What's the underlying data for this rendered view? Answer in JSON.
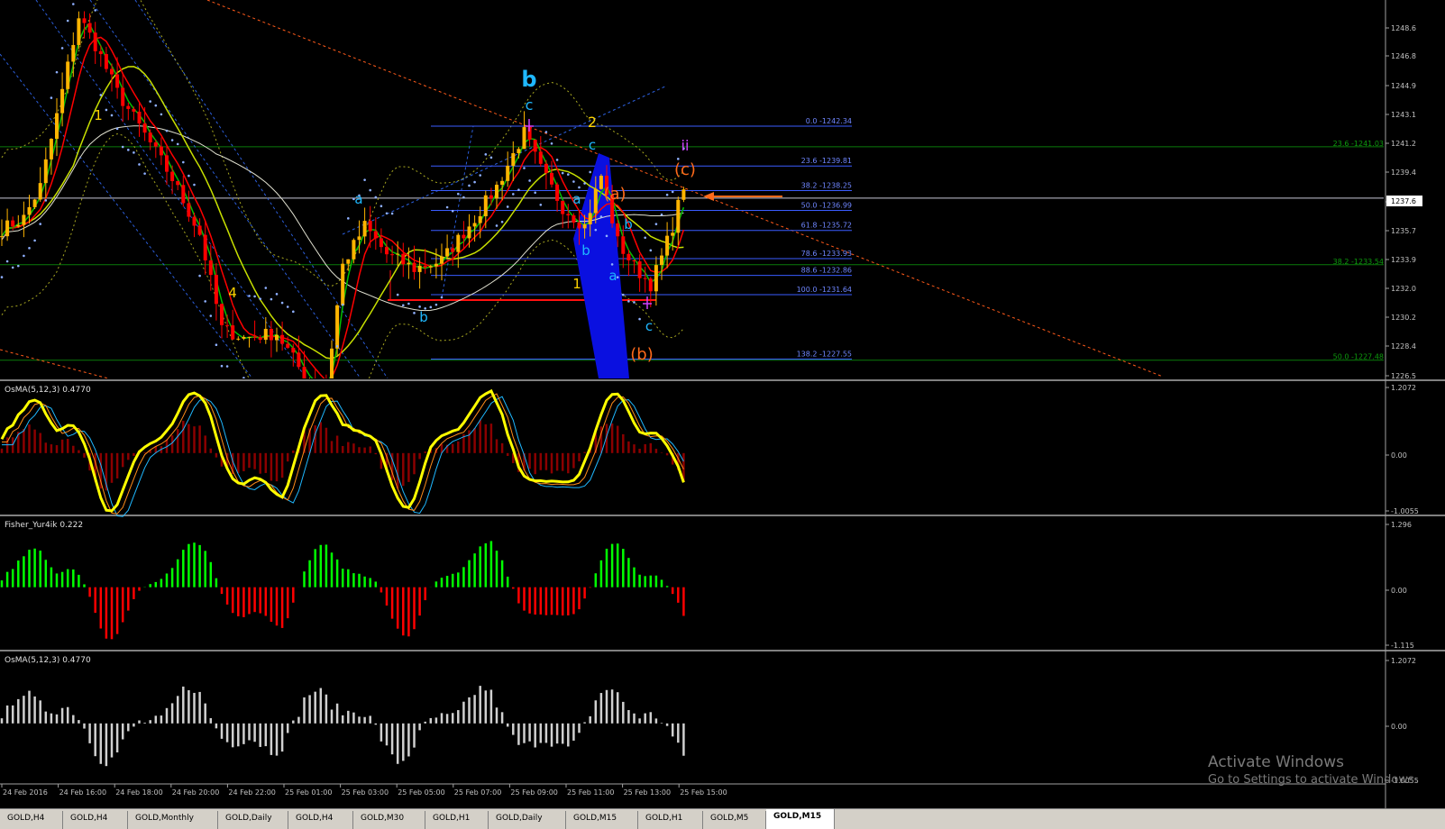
{
  "colors": {
    "bull": "#ffb400",
    "bear": "#ff0000",
    "ma_fast": "#00c000",
    "ma_mid": "#ff0000",
    "ma_slow": "#c8e000",
    "ma_long": "#e0e0d0",
    "fib": "#3a5cff",
    "green_line": "#0a7a0a",
    "osma_line": "#ffff00",
    "fisher_up": "#00ff00",
    "fisher_dn": "#ff0000",
    "osma_hist": "#d0d0d0",
    "wave_cyan": "#1fb8ff",
    "wave_yellow": "#ffd400",
    "wave_orange": "#ff6a1a",
    "wave_magenta": "#d040ff"
  },
  "price_axis": {
    "labels": [
      "1248.6",
      "1246.8",
      "1244.9",
      "1243.1",
      "1241.2",
      "1239.4",
      "1237.6",
      "1235.7",
      "1233.9",
      "1232.0",
      "1230.2",
      "1228.4",
      "1226.5"
    ],
    "current": "1237.6"
  },
  "fib_levels": [
    {
      "label": "0.0 -1242.34",
      "price": 1242.34
    },
    {
      "label": "23.6 -1239.81",
      "price": 1239.81
    },
    {
      "label": "38.2 -1238.25",
      "price": 1238.25
    },
    {
      "label": "50.0 -1236.99",
      "price": 1236.99
    },
    {
      "label": "61.8 -1235.72",
      "price": 1235.72
    },
    {
      "label": "78.6 -1233.93",
      "price": 1233.93
    },
    {
      "label": "88.6 -1232.86",
      "price": 1232.86
    },
    {
      "label": "100.0 -1231.64",
      "price": 1231.64
    },
    {
      "label": "138.2 -1227.55",
      "price": 1227.55
    }
  ],
  "green_levels": [
    {
      "label": "23.6 -1241.03",
      "price": 1241.03
    },
    {
      "label": "38.2 -1233.54",
      "price": 1233.54
    },
    {
      "label": "50.0 -1227.48",
      "price": 1227.48
    }
  ],
  "waves": [
    {
      "t": "b",
      "c": "wave_cyan",
      "s": 24
    },
    {
      "t": "c",
      "c": "wave_cyan",
      "s": 16
    },
    {
      "t": "2",
      "c": "wave_yellow",
      "s": 16
    },
    {
      "t": "c",
      "c": "wave_cyan",
      "s": 15
    },
    {
      "t": "ii",
      "c": "wave_magenta",
      "s": 16
    },
    {
      "t": "(c)",
      "c": "wave_orange",
      "s": 18
    },
    {
      "t": "(a)",
      "c": "wave_orange",
      "s": 18
    },
    {
      "t": "a",
      "c": "wave_cyan",
      "s": 15
    },
    {
      "t": "b",
      "c": "wave_cyan",
      "s": 15
    },
    {
      "t": "b",
      "c": "wave_cyan",
      "s": 15
    },
    {
      "t": "a",
      "c": "wave_cyan",
      "s": 15
    },
    {
      "t": "1",
      "c": "wave_yellow",
      "s": 15
    },
    {
      "t": "c",
      "c": "wave_cyan",
      "s": 15
    },
    {
      "t": "(b)",
      "c": "wave_orange",
      "s": 18
    },
    {
      "t": "a",
      "c": "wave_cyan",
      "s": 15
    },
    {
      "t": "b",
      "c": "wave_cyan",
      "s": 15
    },
    {
      "t": "1",
      "c": "wave_yellow",
      "s": 15
    },
    {
      "t": "4",
      "c": "wave_yellow",
      "s": 15
    }
  ],
  "panels": [
    {
      "title": "OsMA(5,12,3) 0.4770",
      "axis": [
        "1.2072",
        "0.00",
        "-1.0055"
      ]
    },
    {
      "title": "Fisher_Yur4ik 0.222",
      "axis": [
        "1.296",
        "0.00",
        "-1.115"
      ]
    },
    {
      "title": "OsMA(5,12,3) 0.4770",
      "axis": [
        "1.2072",
        "0.00",
        "-1.0055"
      ]
    }
  ],
  "time_axis": [
    "24 Feb 2016",
    "24 Feb 16:00",
    "24 Feb 18:00",
    "24 Feb 20:00",
    "24 Feb 22:00",
    "25 Feb 01:00",
    "25 Feb 03:00",
    "25 Feb 05:00",
    "25 Feb 07:00",
    "25 Feb 09:00",
    "25 Feb 11:00",
    "25 Feb 13:00",
    "25 Feb 15:00"
  ],
  "tabs": [
    "GOLD,H4",
    "GOLD,H4",
    "GOLD,Monthly",
    "GOLD,Daily",
    "GOLD,H4",
    "GOLD,M30",
    "GOLD,H1",
    "GOLD,Daily",
    "GOLD,M15",
    "GOLD,H1",
    "GOLD,M5",
    "GOLD,M15"
  ],
  "active_tab": 11,
  "watermark": {
    "line1": "Activate Windows",
    "line2": "Go to Settings to activate Windows."
  }
}
